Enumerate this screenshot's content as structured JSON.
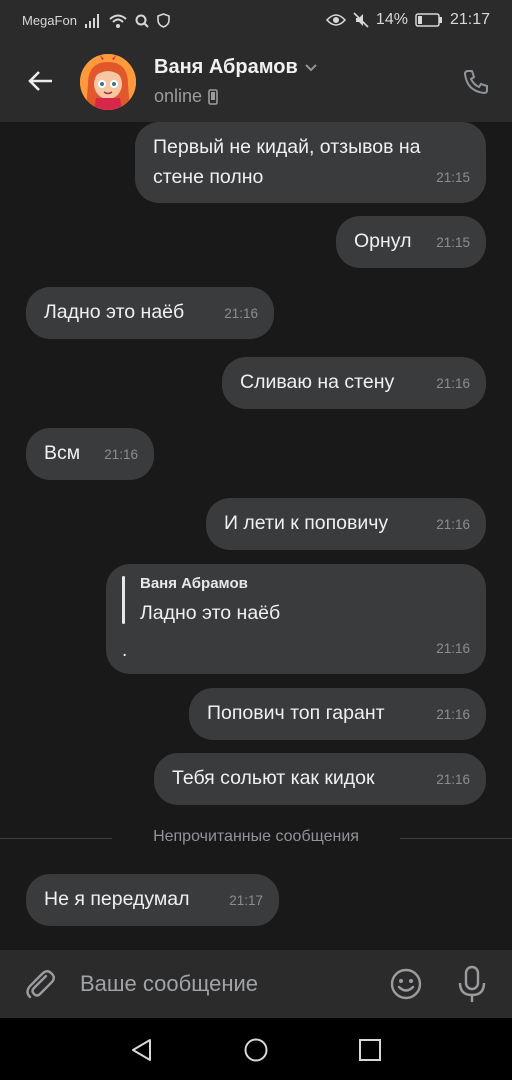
{
  "status_bar": {
    "carrier": "MegaFon",
    "battery_percent": "14%",
    "time": "21:17",
    "icons": [
      "signal-icon",
      "wifi-icon",
      "search-icon",
      "shield-icon",
      "eye-icon",
      "mute-icon",
      "battery-icon"
    ]
  },
  "header": {
    "contact_name": "Ваня Абрамов",
    "status": "online",
    "icons": [
      "back-arrow-icon",
      "chevron-down-icon",
      "phone-device-icon",
      "phone-call-icon"
    ]
  },
  "messages": [
    {
      "text": "Первый не кидай, отзывов на\nстене полно",
      "time": "21:15",
      "outgoing": true
    },
    {
      "text": "Орнул",
      "time": "21:15",
      "outgoing": true
    },
    {
      "text": "Ладно это наёб",
      "time": "21:16",
      "outgoing": false
    },
    {
      "text": "Сливаю на стену",
      "time": "21:16",
      "outgoing": true
    },
    {
      "text": "Всм",
      "time": "21:16",
      "outgoing": false
    },
    {
      "text": "И лети к поповичу",
      "time": "21:16",
      "outgoing": true
    },
    {
      "reply_author": "Ваня Абрамов",
      "reply_text": "Ладно это наёб",
      "text": ".",
      "time": "21:16",
      "outgoing": true
    },
    {
      "text": "Попович топ гарант",
      "time": "21:16",
      "outgoing": true
    },
    {
      "text": "Тебя сольют как кидок",
      "time": "21:16",
      "outgoing": true
    },
    {
      "text": "Не я передумал",
      "time": "21:17",
      "outgoing": false
    }
  ],
  "unread_divider": "Непрочитанные сообщения",
  "composer": {
    "placeholder": "Ваше сообщение",
    "icons": [
      "attach-icon",
      "emoji-icon",
      "microphone-icon"
    ]
  },
  "nav_bar": {
    "icons": [
      "nav-back-icon",
      "nav-home-icon",
      "nav-recents-icon"
    ]
  },
  "colors": {
    "background": "#19191a",
    "bar": "#2b2b2c",
    "bubble": "#3a3b3c",
    "text": "#eef0f2",
    "time": "#8a8d91"
  }
}
